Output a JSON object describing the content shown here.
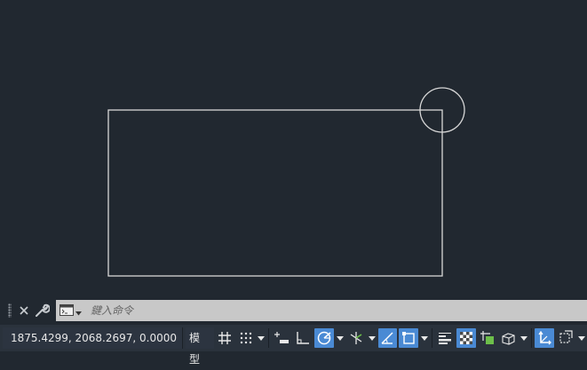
{
  "command_line": {
    "placeholder": "鍵入命令"
  },
  "status_bar": {
    "coordinates": "1875.4299, 2068.2697, 0.0000",
    "model_label": "模型"
  },
  "colors": {
    "canvas_bg": "#212830",
    "geometry": "#d8d8d8",
    "command_input_bg": "#c8c8c8",
    "statusbar_bg": "#2a323c",
    "toggle_on": "#4a8ad4"
  },
  "icons": [
    "close-icon",
    "wrench-icon",
    "command-prompt-icon",
    "grid-icon",
    "snap-icon",
    "infer-constraints-icon",
    "ortho-icon",
    "polar-tracking-icon",
    "isometric-icon",
    "object-snap-tracking-icon",
    "object-snap-icon",
    "lineweight-icon",
    "transparency-icon",
    "selection-cycling-icon",
    "3d-object-snap-icon",
    "dynamic-ucs-icon",
    "selection-filter-icon"
  ]
}
